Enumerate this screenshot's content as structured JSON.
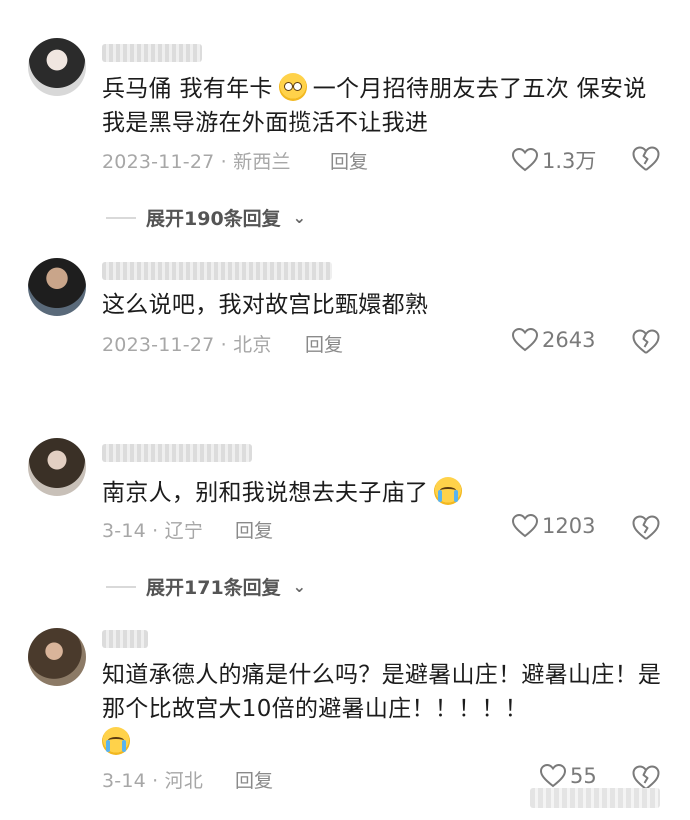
{
  "comments": [
    {
      "text_before": "兵马俑 我有年卡",
      "emoji": "shy-face-icon",
      "text_after": "一个月招待朋友去了五次 保安说我是黑导游在外面揽活不让我进",
      "meta": "2023-11-27 · 新西兰",
      "reply": "回复",
      "likes": "1.3万",
      "expand": "展开190条回复"
    },
    {
      "text_before": "这么说吧，我对故宫比甄嬛都熟",
      "meta": "2023-11-27 · 北京",
      "reply": "回复",
      "likes": "2643"
    },
    {
      "text_before": "南京人，别和我说想去夫子庙了",
      "emoji": "crying-face-icon",
      "meta": "3-14 · 辽宁",
      "reply": "回复",
      "likes": "1203",
      "expand": "展开171条回复"
    },
    {
      "text_before": "知道承德人的痛是什么吗？是避暑山庄！避暑山庄！是那个比故宫大10倍的避暑山庄！！！！！",
      "emoji": "loudly-crying-face-icon",
      "meta": "3-14 · 河北",
      "reply": "回复",
      "likes": "55"
    }
  ]
}
